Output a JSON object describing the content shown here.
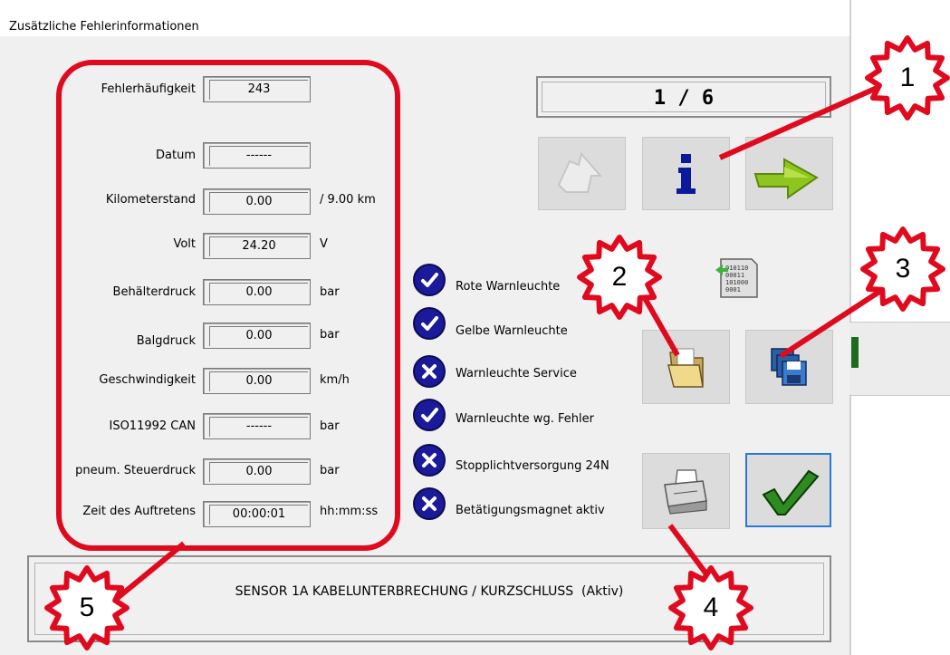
{
  "window": {
    "title": "Zusätzliche Fehlerinformationen"
  },
  "counter": "1 / 6",
  "fields": [
    {
      "label": "Fehlerhäufigkeit",
      "value": "243",
      "unit": ""
    },
    {
      "label": "Datum",
      "value": "------",
      "unit": ""
    },
    {
      "label": "Kilometerstand",
      "value": "0.00",
      "unit": "/ 9.00 km"
    },
    {
      "label": "Volt",
      "value": "24.20",
      "unit": "V"
    },
    {
      "label": "Behälterdruck",
      "value": "0.00",
      "unit": "bar"
    },
    {
      "label": "Balgdruck",
      "value": "0.00",
      "unit": "bar"
    },
    {
      "label": "Geschwindigkeit",
      "value": "0.00",
      "unit": "km/h"
    },
    {
      "label": "ISO11992 CAN",
      "value": "------",
      "unit": "bar"
    },
    {
      "label": "pneum. Steuerdruck",
      "value": "0.00",
      "unit": "bar"
    },
    {
      "label": "Zeit des Auftretens",
      "value": "00:00:01",
      "unit": "hh:mm:ss"
    }
  ],
  "statuses": [
    {
      "label": "Rote Warnleuchte",
      "state": "check"
    },
    {
      "label": "Gelbe Warnleuchte",
      "state": "check"
    },
    {
      "label": "Warnleuchte Service",
      "state": "cross"
    },
    {
      "label": "Warnleuchte wg. Fehler",
      "state": "check"
    },
    {
      "label": "Stopplichtversorgung 24N",
      "state": "cross"
    },
    {
      "label": "Betätigungsmagnet aktiv",
      "state": "cross"
    }
  ],
  "buttons": {
    "back": "back-arrow-icon",
    "info": "info-icon",
    "forward": "forward-arrow-icon",
    "binary": "binary-data-icon",
    "open": "folder-icon",
    "save": "floppy-disks-icon",
    "print": "printer-icon",
    "ok": "checkmark-icon"
  },
  "message": "SENSOR 1A KABELUNTERBRECHUNG / KURZSCHLUSS  (Aktiv)",
  "callouts": [
    "1",
    "2",
    "3",
    "4",
    "5"
  ],
  "colors": {
    "annotation_red": "#e00a1e",
    "status_blue": "#1a1a9a",
    "ok_green": "#2e8b1f"
  }
}
